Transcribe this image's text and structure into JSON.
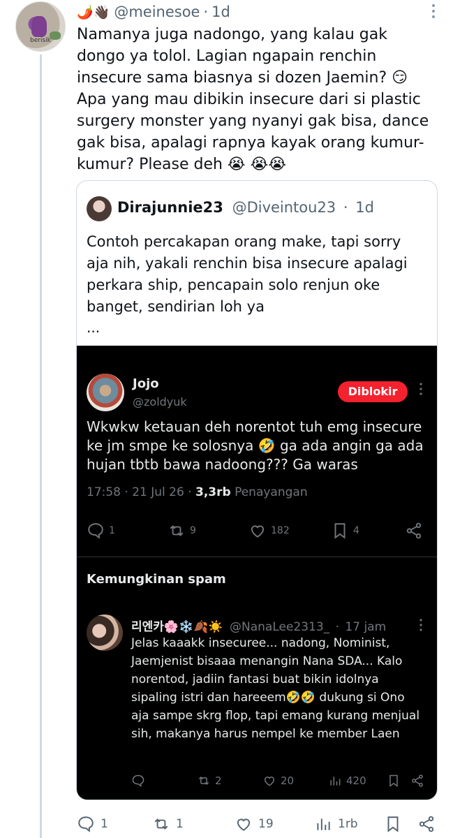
{
  "tweet": {
    "author_emojis": "🌶️👋🏿",
    "handle": "@meinesoe",
    "sep": "·",
    "time": "1d",
    "avatar_text": "berisik",
    "text": "Namanya juga nadongo, yang kalau gak dongo ya tolol. Lagian ngapain renchin insecure sama biasnya si dozen Jaemin? 😏 Apa yang mau dibikin insecure dari si plastic surgery monster yang nyanyi gak bisa, dance gak bisa, apalagi rapnya kayak orang kumur-kumur? Please deh 😭 😭😭",
    "actions": {
      "replies": "1",
      "retweets": "1",
      "likes": "19",
      "views": "1rb"
    }
  },
  "quote": {
    "name": "Dirajunnie23",
    "handle": "@Diveintou23",
    "sep": "·",
    "time": "1d",
    "text": "Contoh percakapan orang make, tapi sorry aja nih, yakali renchin bisa insecure apalagi perkara ship, pencapain solo renjun oke banget, sendirian loh ya",
    "ellipsis": "..."
  },
  "embedded": {
    "post": {
      "name": "Jojo",
      "handle": "@zoldyuk",
      "block_label": "Diblokir",
      "text": "Wkwkw ketauan deh norentot tuh emg insecure ke jm smpe ke solosnya 🤣 ga ada angin ga ada hujan tbtb bawa nadoong??? Ga waras",
      "time": "17:58 · 21 Jul 26 ·",
      "views_count": "3,3rb",
      "views_label": "Penayangan",
      "actions": {
        "replies": "1",
        "retweets": "9",
        "likes": "182",
        "bookmarks": "4"
      }
    },
    "spam_label": "Kemungkinan spam",
    "reply": {
      "name": "리엔카🌸❄️🍂☀️",
      "handle": "@NanaLee2313_",
      "sep": "·",
      "time": "17 jam",
      "text": "Jelas kaaakk insecuree... nadong, Nominist, Jaemjenist bisaaa menangin Nana SDA... Kalo norentod, jadiin  fantasi buat bikin idolnya sipaling istri dan hareeem🤣🤣 dukung si Ono aja sampe skrg flop, tapi emang kurang menjual sih, makanya harus nempel ke member Laen",
      "actions": {
        "retweets": "2",
        "likes": "20",
        "views": "420"
      }
    }
  },
  "colors": {
    "text": "#0f1419",
    "secondary": "#536471",
    "border": "#cfd9de",
    "dark_bg": "#000000",
    "block_red": "#f4212e"
  }
}
